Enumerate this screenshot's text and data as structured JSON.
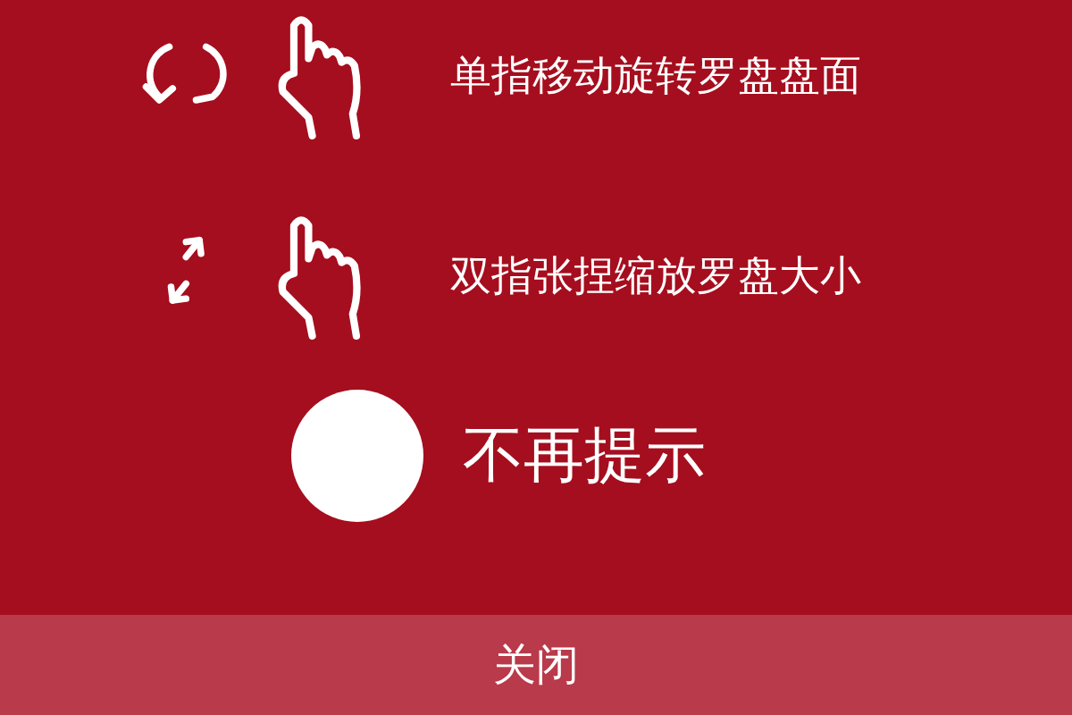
{
  "gestures": [
    {
      "kind": "rotate",
      "text": "单指移动旋转罗盘盘面"
    },
    {
      "kind": "pinch",
      "text": "双指张捏缩放罗盘大小"
    }
  ],
  "dont_show_again": {
    "label": "不再提示",
    "checked": false
  },
  "close_button": {
    "label": "关闭"
  }
}
